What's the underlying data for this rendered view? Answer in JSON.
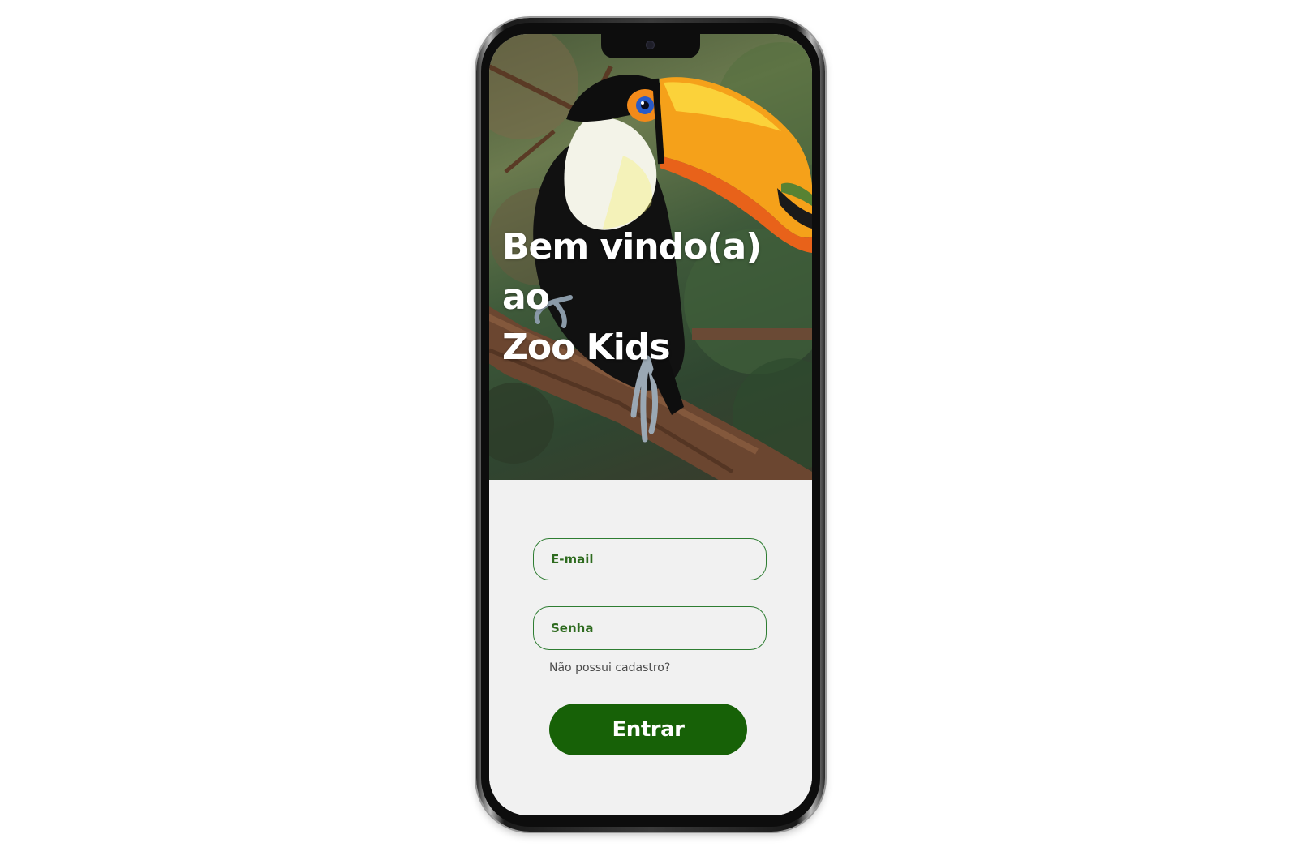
{
  "welcome": {
    "line1": "Bem vindo(a)",
    "line2": "ao",
    "line3": "Zoo Kids"
  },
  "hero_image": {
    "subject": "toucan-on-branch"
  },
  "form": {
    "email_placeholder": "E-mail",
    "password_placeholder": "Senha",
    "signup_link": "Não possui cadastro?",
    "submit_label": "Entrar"
  },
  "colors": {
    "primary_green": "#176107",
    "field_border": "#2e7d32",
    "field_text": "#2e6b1f",
    "form_background": "#f1f1f1"
  }
}
